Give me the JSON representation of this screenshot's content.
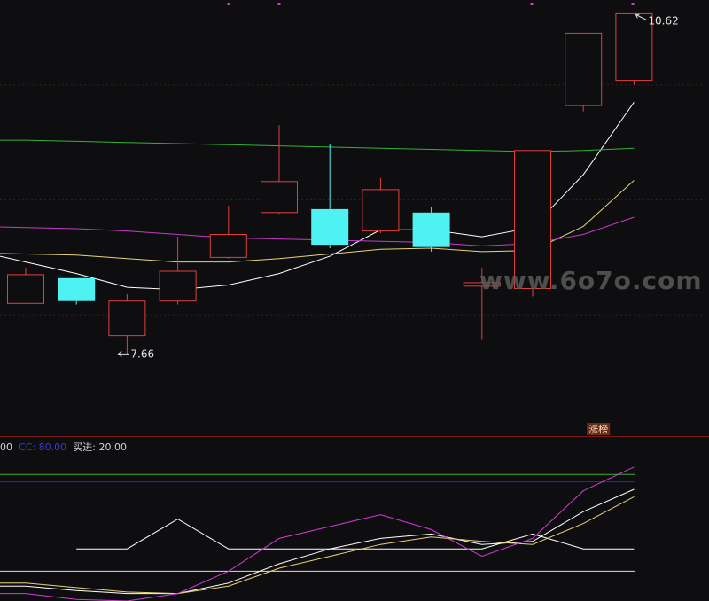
{
  "chart_data": [
    {
      "type": "candlestick",
      "price_scale": {
        "min": 7.0,
        "max": 10.7
      },
      "candles": [
        {
          "open": 8.1,
          "close": 8.35,
          "high": 8.41,
          "low": 8.1
        },
        {
          "open": 8.32,
          "close": 8.12,
          "high": 8.32,
          "low": 8.09
        },
        {
          "open": 7.82,
          "close": 8.12,
          "high": 8.18,
          "low": 7.66
        },
        {
          "open": 8.12,
          "close": 8.38,
          "high": 8.68,
          "low": 8.09
        },
        {
          "open": 8.5,
          "close": 8.7,
          "high": 8.95,
          "low": 8.49
        },
        {
          "open": 8.89,
          "close": 9.16,
          "high": 9.65,
          "low": 8.88
        },
        {
          "open": 8.92,
          "close": 8.61,
          "high": 9.49,
          "low": 8.58
        },
        {
          "open": 8.73,
          "close": 9.09,
          "high": 9.19,
          "low": 8.71
        },
        {
          "open": 8.89,
          "close": 8.59,
          "high": 8.94,
          "low": 8.55
        },
        {
          "open": 8.25,
          "close": 8.28,
          "high": 8.41,
          "low": 7.79
        },
        {
          "open": 8.23,
          "close": 9.43,
          "high": 9.43,
          "low": 8.16
        },
        {
          "open": 9.82,
          "close": 10.45,
          "high": 10.45,
          "low": 9.77
        },
        {
          "open": 10.04,
          "close": 10.62,
          "high": 10.62,
          "low": 10.0
        }
      ],
      "ma_lines": [
        {
          "color": "#ffffff",
          "values": [
            8.46,
            8.36,
            8.24,
            8.22,
            8.26,
            8.36,
            8.51,
            8.74,
            8.74,
            8.68,
            8.76,
            9.22,
            9.85
          ]
        },
        {
          "color": "#e8d37a",
          "values": [
            8.53,
            8.52,
            8.49,
            8.46,
            8.46,
            8.49,
            8.53,
            8.57,
            8.58,
            8.55,
            8.56,
            8.77,
            9.17
          ]
        },
        {
          "color": "#c43cc4",
          "values": [
            8.76,
            8.75,
            8.73,
            8.7,
            8.67,
            8.66,
            8.65,
            8.64,
            8.63,
            8.6,
            8.62,
            8.7,
            8.85
          ]
        },
        {
          "color": "#33b233",
          "values": [
            9.52,
            9.51,
            9.5,
            9.49,
            9.48,
            9.47,
            9.46,
            9.45,
            9.44,
            9.43,
            9.42,
            9.43,
            9.45
          ]
        }
      ],
      "annotations": [
        {
          "text": "10.62",
          "candle": 12
        },
        {
          "text": "7.66",
          "candle": 2
        },
        {
          "text": "涨榜",
          "candle": 11
        }
      ]
    },
    {
      "type": "line",
      "ylim": [
        0,
        100
      ],
      "legend_items": [
        {
          "text": "00",
          "color": "#d0d0d0"
        },
        {
          "text": "CC: 80.00",
          "color": "#3a3ad8"
        },
        {
          "text": "买进: 20.00",
          "color": "#d0d0d0"
        }
      ],
      "reference_lines": [
        {
          "value": 85,
          "color": "#33b233"
        },
        {
          "value": 80,
          "color": "#2323e6"
        },
        {
          "value": 20,
          "color": "#dddddd"
        }
      ],
      "series": [
        {
          "color": "#ffffff",
          "values": [
            null,
            35,
            35,
            55,
            35,
            35,
            35,
            35,
            35,
            35,
            45,
            35,
            35
          ]
        },
        {
          "color": "#ffffff",
          "values": [
            10,
            7,
            5,
            5,
            12,
            25,
            35,
            42,
            45,
            38,
            40,
            60,
            75
          ]
        },
        {
          "color": "#e8d37a",
          "values": [
            12,
            9,
            6,
            5,
            10,
            22,
            30,
            38,
            43,
            40,
            38,
            52,
            70
          ]
        },
        {
          "color": "#d33cd3",
          "values": [
            5,
            1,
            0,
            5,
            20,
            42,
            50,
            58,
            48,
            30,
            42,
            74,
            90
          ]
        }
      ]
    }
  ],
  "watermark": {
    "text": "www.6o7o.com"
  }
}
